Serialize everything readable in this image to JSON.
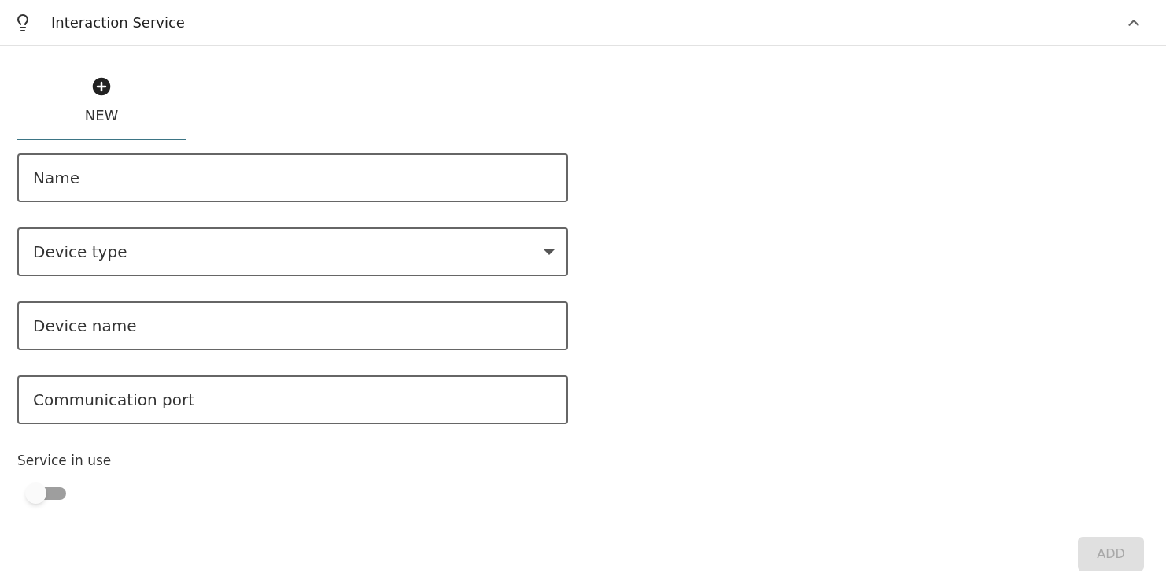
{
  "panel": {
    "title": "Interaction Service",
    "expanded": true
  },
  "tabs": [
    {
      "label": "NEW",
      "selected": true
    }
  ],
  "fields": [
    {
      "kind": "text",
      "placeholder": "Name"
    },
    {
      "kind": "select",
      "placeholder": "Device type"
    },
    {
      "kind": "text",
      "placeholder": "Device name"
    },
    {
      "kind": "text",
      "placeholder": "Communication port"
    }
  ],
  "toggle": {
    "label": "Service in use",
    "on": false
  },
  "add_button": {
    "label": "ADD",
    "disabled": true
  }
}
